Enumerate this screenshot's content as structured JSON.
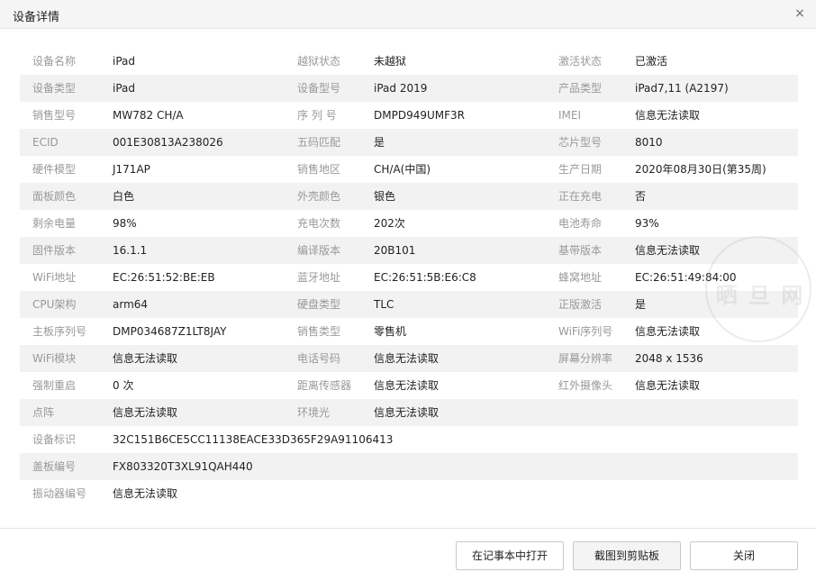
{
  "dialog": {
    "title": "设备详情",
    "close_glyph": "×"
  },
  "rows": [
    [
      [
        "设备名称",
        "iPad"
      ],
      [
        "越狱状态",
        "未越狱"
      ],
      [
        "激活状态",
        "已激活"
      ]
    ],
    [
      [
        "设备类型",
        "iPad"
      ],
      [
        "设备型号",
        "iPad 2019"
      ],
      [
        "产品类型",
        "iPad7,11 (A2197)"
      ]
    ],
    [
      [
        "销售型号",
        "MW782 CH/A"
      ],
      [
        "序 列 号",
        "DMPD949UMF3R"
      ],
      [
        "IMEI",
        "信息无法读取"
      ]
    ],
    [
      [
        "ECID",
        "001E30813A238026"
      ],
      [
        "五码匹配",
        "是"
      ],
      [
        "芯片型号",
        "8010"
      ]
    ],
    [
      [
        "硬件模型",
        "J171AP"
      ],
      [
        "销售地区",
        "CH/A(中国)"
      ],
      [
        "生产日期",
        "2020年08月30日(第35周)"
      ]
    ],
    [
      [
        "面板颜色",
        "白色"
      ],
      [
        "外壳颜色",
        "银色"
      ],
      [
        "正在充电",
        "否"
      ]
    ],
    [
      [
        "剩余电量",
        "98%"
      ],
      [
        "充电次数",
        "202次"
      ],
      [
        "电池寿命",
        "93%"
      ]
    ],
    [
      [
        "固件版本",
        "16.1.1"
      ],
      [
        "编译版本",
        "20B101"
      ],
      [
        "基带版本",
        "信息无法读取"
      ]
    ],
    [
      [
        "WiFi地址",
        "EC:26:51:52:BE:EB"
      ],
      [
        "蓝牙地址",
        "EC:26:51:5B:E6:C8"
      ],
      [
        "蜂窝地址",
        "EC:26:51:49:84:00"
      ]
    ],
    [
      [
        "CPU架构",
        "arm64"
      ],
      [
        "硬盘类型",
        "TLC"
      ],
      [
        "正版激活",
        "是"
      ]
    ],
    [
      [
        "主板序列号",
        "DMP034687Z1LT8JAY"
      ],
      [
        "销售类型",
        "零售机"
      ],
      [
        "WiFi序列号",
        "信息无法读取"
      ]
    ],
    [
      [
        "WiFi模块",
        "信息无法读取"
      ],
      [
        "电话号码",
        "信息无法读取"
      ],
      [
        "屏幕分辨率",
        "2048 x 1536"
      ]
    ],
    [
      [
        "强制重启",
        "0 次"
      ],
      [
        "距离传感器",
        "信息无法读取"
      ],
      [
        "红外摄像头",
        "信息无法读取"
      ]
    ],
    [
      [
        "点阵",
        "信息无法读取"
      ],
      [
        "环境光",
        "信息无法读取"
      ],
      null
    ],
    [
      [
        "设备标识",
        "32C151B6CE5CC11138EACE33D365F29A91106413"
      ],
      null,
      null
    ],
    [
      [
        "盖板编号",
        "FX803320T3XL91QAH440"
      ],
      null,
      null
    ],
    [
      [
        "振动器编号",
        "信息无法读取"
      ],
      null,
      null
    ]
  ],
  "watermark": {
    "text": "晒 旦 网"
  },
  "footer": {
    "open_notepad": "在记事本中打开",
    "copy_screenshot": "截图到剪贴板",
    "close": "关闭"
  }
}
